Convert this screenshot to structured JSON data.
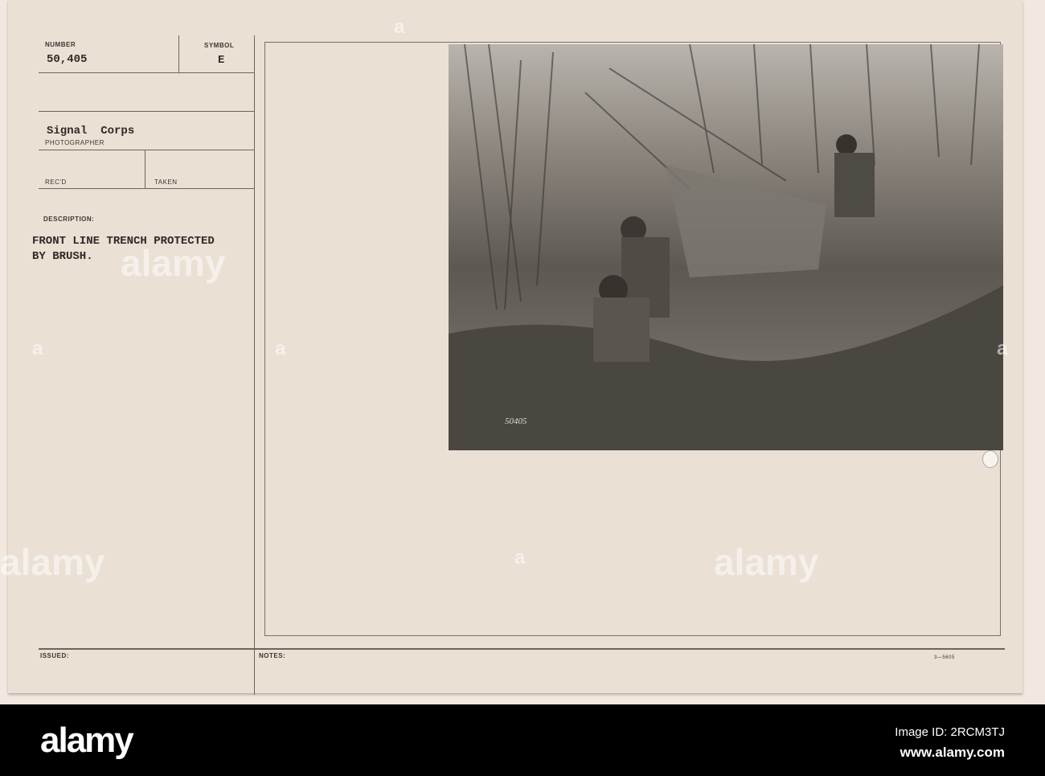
{
  "form": {
    "number_label": "NUMBER",
    "number_value": "50,405",
    "symbol_label": "SYMBOL",
    "symbol_value": "E",
    "photographer_value": "Signal  Corps",
    "photographer_label": "PHOTOGRAPHER",
    "recd_label": "REC'D",
    "taken_label": "TAKEN",
    "description_label": "DESCRIPTION:",
    "description_line1": "FRONT LINE TRENCH PROTECTED",
    "description_line2": "BY BRUSH.",
    "issued_label": "ISSUED:",
    "notes_label": "NOTES:",
    "form_code": "3—5605"
  },
  "photo": {
    "negative_number": "50405"
  },
  "footer": {
    "logo": "alamy",
    "image_id": "Image ID: 2RCM3TJ",
    "site": "www.alamy.com"
  },
  "watermark": {
    "text": "alamy",
    "mark": "a"
  }
}
